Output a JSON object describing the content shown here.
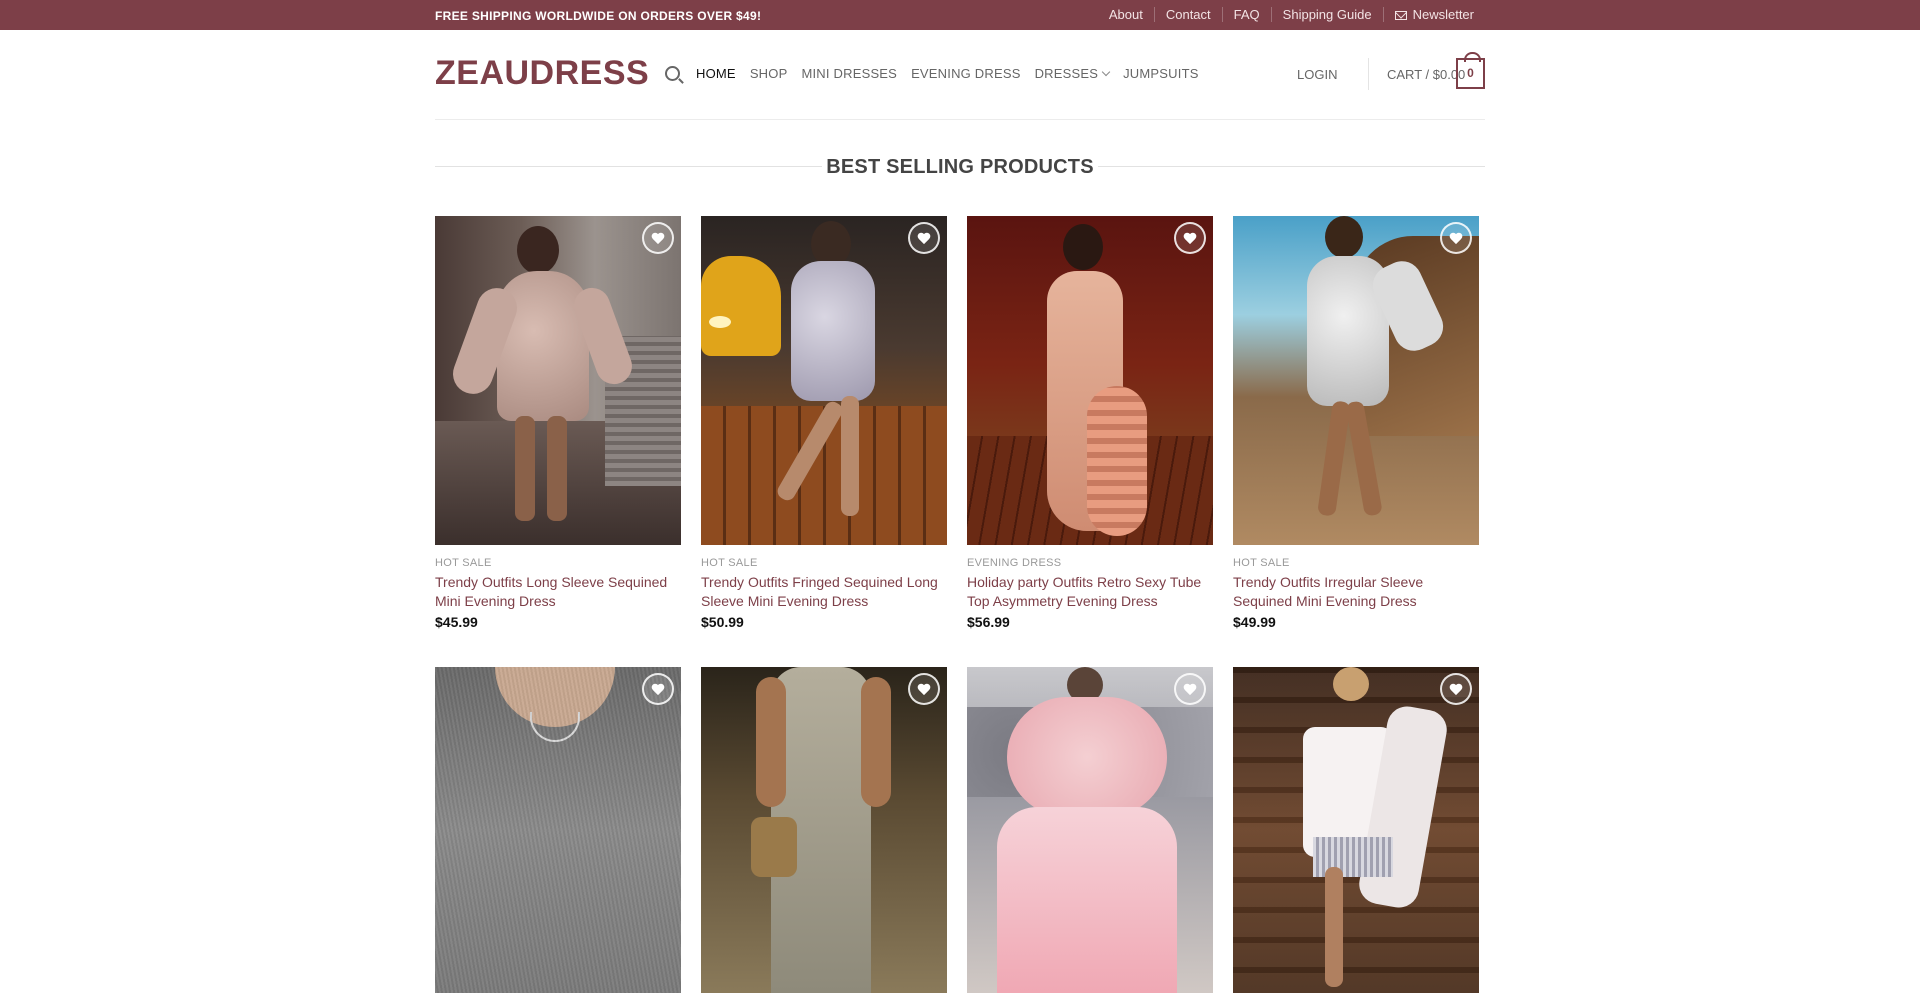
{
  "topbar": {
    "promo": "FREE SHIPPING WORLDWIDE ON ORDERS OVER $49!",
    "links": [
      "About",
      "Contact",
      "FAQ",
      "Shipping Guide",
      "Newsletter"
    ]
  },
  "header": {
    "logo": "ZEAUDRESS",
    "nav": [
      "HOME",
      "SHOP",
      "MINI DRESSES",
      "EVENING DRESS",
      "DRESSES",
      "JUMPSUITS"
    ],
    "login": "LOGIN",
    "cart_label": "CART / $0.00",
    "cart_count": "0"
  },
  "section": {
    "title": "BEST SELLING PRODUCTS"
  },
  "products": [
    {
      "category": "HOT SALE",
      "name": "Trendy Outfits Long Sleeve Sequined Mini Evening Dress",
      "price": "$45.99"
    },
    {
      "category": "HOT SALE",
      "name": "Trendy Outfits Fringed Sequined Long Sleeve Mini Evening Dress",
      "price": "$50.99"
    },
    {
      "category": "EVENING DRESS",
      "name": "Holiday party Outfits Retro Sexy Tube Top Asymmetry Evening Dress",
      "price": "$56.99"
    },
    {
      "category": "HOT SALE",
      "name": "Trendy Outfits Irregular Sleeve Sequined Mini Evening Dress",
      "price": "$49.99"
    }
  ],
  "colors": {
    "brand": "#7d3f48",
    "topbar": "#7d3f48"
  }
}
